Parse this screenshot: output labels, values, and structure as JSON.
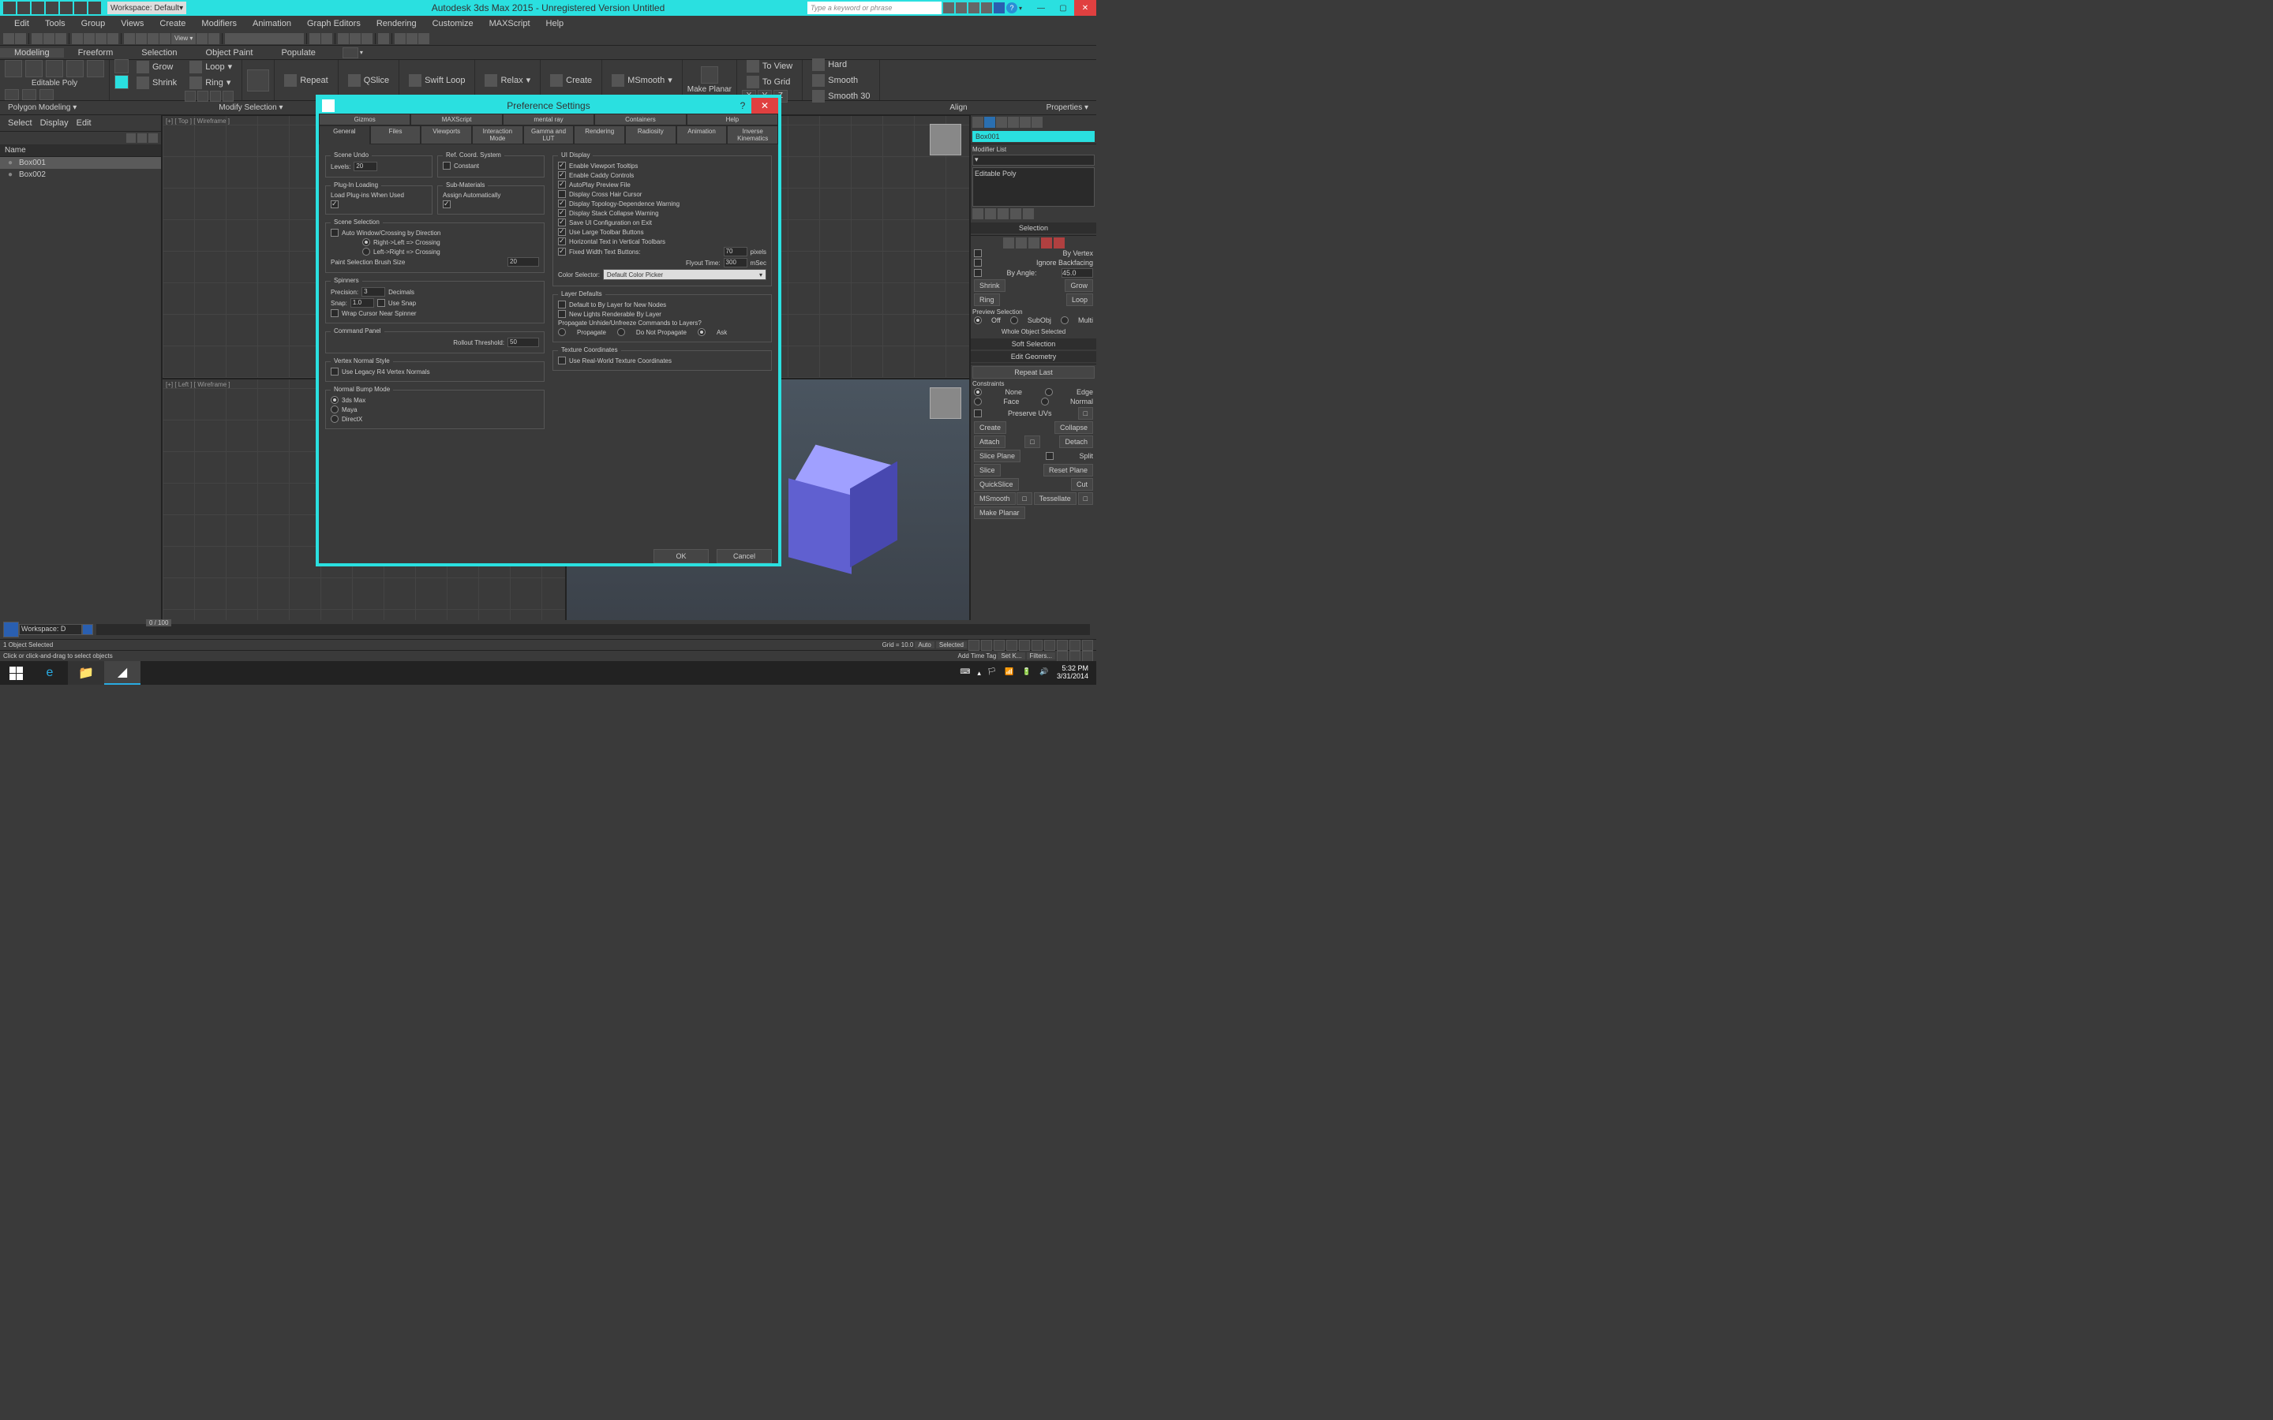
{
  "titlebar": {
    "workspace_label": "Workspace: Default",
    "title": "Autodesk 3ds Max  2015  - Unregistered Version    Untitled",
    "search_placeholder": "Type a keyword or phrase"
  },
  "menus": [
    "Edit",
    "Tools",
    "Group",
    "Views",
    "Create",
    "Modifiers",
    "Animation",
    "Graph Editors",
    "Rendering",
    "Customize",
    "MAXScript",
    "Help"
  ],
  "ribbon_tabs": [
    "Modeling",
    "Freeform",
    "Selection",
    "Object Paint",
    "Populate"
  ],
  "ribbon": {
    "editable_poly": "Editable Poly",
    "grow": "Grow",
    "shrink": "Shrink",
    "loop": "Loop",
    "ring": "Ring",
    "repeat": "Repeat",
    "qslice": "QSlice",
    "swiftloop": "Swift Loop",
    "relax": "Relax",
    "create": "Create",
    "msmooth": "MSmooth",
    "make_planar": "Make Planar",
    "to_view": "To View",
    "to_grid": "To Grid",
    "x": "X",
    "y": "Y",
    "z": "Z",
    "hard": "Hard",
    "smooth": "Smooth",
    "smooth30": "Smooth 30"
  },
  "ribbon_subtabs": [
    "Polygon Modeling ▾",
    "Modify Selection ▾",
    "Align",
    "Properties ▾"
  ],
  "left_panel": {
    "tabs": [
      "Select",
      "Display",
      "Edit"
    ],
    "header": "Name",
    "items": [
      "Box001",
      "Box002"
    ]
  },
  "viewports": {
    "tl": "[+] [ Top ] [ Wireframe ]",
    "tr": "",
    "bl": "[+] [ Left ] [ Wireframe ]",
    "br": ""
  },
  "dialog": {
    "title": "Preference Settings",
    "tabs_row1": [
      "Gizmos",
      "MAXScript",
      "mental ray",
      "Containers",
      "Help"
    ],
    "tabs_row2": [
      "General",
      "Files",
      "Viewports",
      "Interaction Mode",
      "Gamma and LUT",
      "Rendering",
      "Radiosity",
      "Animation",
      "Inverse Kinematics"
    ],
    "scene_undo": "Scene Undo",
    "levels": "Levels:",
    "levels_val": "20",
    "ref_coord": "Ref. Coord. System",
    "constant": "Constant",
    "plugin_loading": "Plug-In Loading",
    "load_plugins": "Load Plug-ins When Used",
    "sub_materials": "Sub-Materials",
    "assign_auto": "Assign Automatically",
    "scene_selection": "Scene Selection",
    "auto_window": "Auto Window/Crossing by Direction",
    "right_left": "Right->Left => Crossing",
    "left_right": "Left->Right => Crossing",
    "paint_brush": "Paint Selection Brush Size",
    "paint_val": "20",
    "spinners": "Spinners",
    "precision": "Precision:",
    "precision_val": "3",
    "decimals": "Decimals",
    "snap": "Snap:",
    "snap_val": "1.0",
    "use_snap": "Use Snap",
    "wrap_cursor": "Wrap Cursor Near Spinner",
    "command_panel": "Command Panel",
    "rollout_threshold": "Rollout Threshold:",
    "rollout_val": "50",
    "vertex_normal": "Vertex Normal Style",
    "use_legacy": "Use Legacy R4 Vertex Normals",
    "normal_bump": "Normal Bump Mode",
    "nbm_3dsmax": "3ds Max",
    "nbm_maya": "Maya",
    "nbm_directx": "DirectX",
    "ui_display": "UI Display",
    "enable_tooltips": "Enable Viewport Tooltips",
    "enable_caddy": "Enable Caddy Controls",
    "autoplay": "AutoPlay Preview File",
    "crosshair": "Display Cross Hair Cursor",
    "topology_warn": "Display Topology-Dependence Warning",
    "stack_warn": "Display Stack Collapse Warning",
    "save_ui": "Save UI Configuration on Exit",
    "large_toolbar": "Use Large Toolbar Buttons",
    "horiz_text": "Horizontal Text in Vertical Toolbars",
    "fixed_width": "Fixed Width Text Buttons:",
    "fixed_width_val": "70",
    "pixels": "pixels",
    "flyout": "Flyout Time:",
    "flyout_val": "300",
    "msec": "mSec",
    "color_selector": "Color Selector:",
    "color_selector_val": "Default Color Picker",
    "layer_defaults": "Layer Defaults",
    "default_by_layer": "Default to By Layer for New Nodes",
    "new_lights": "New Lights Renderable By Layer",
    "propagate_cmd": "Propagate Unhide/Unfreeze Commands to Layers?",
    "propagate": "Propagate",
    "do_not": "Do Not Propagate",
    "ask": "Ask",
    "tex_coords": "Texture Coordinates",
    "use_realworld": "Use Real-World Texture Coordinates",
    "ok": "OK",
    "cancel": "Cancel"
  },
  "right_panel": {
    "obj_name": "Box001",
    "modifier_list": "Modifier List",
    "editable_poly": "Editable Poly",
    "selection": "Selection",
    "by_vertex": "By Vertex",
    "ignore_backfacing": "Ignore Backfacing",
    "by_angle": "By Angle:",
    "by_angle_val": "45.0",
    "shrink": "Shrink",
    "grow": "Grow",
    "ring": "Ring",
    "loop": "Loop",
    "preview_sel": "Preview Selection",
    "off": "Off",
    "subobj": "SubObj",
    "multi": "Multi",
    "whole_object": "Whole Object Selected",
    "soft_selection": "Soft Selection",
    "edit_geometry": "Edit Geometry",
    "repeat_last": "Repeat Last",
    "constraints": "Constraints",
    "none": "None",
    "edge": "Edge",
    "face": "Face",
    "normal": "Normal",
    "preserve_uvs": "Preserve UVs",
    "create": "Create",
    "collapse": "Collapse",
    "attach": "Attach",
    "detach": "Detach",
    "slice_plane": "Slice Plane",
    "split": "Split",
    "slice": "Slice",
    "reset_plane": "Reset Plane",
    "quickslice": "QuickSlice",
    "cut": "Cut",
    "msmooth": "MSmooth",
    "tessellate": "Tessellate",
    "make_planar": "Make Planar"
  },
  "status": {
    "objects_selected": "1 Object Selected",
    "prompt": "Click or click-and-drag to select objects",
    "workspace": "Workspace: D",
    "grid": "Grid = 10.0",
    "add_time_tag": "Add Time Tag",
    "auto": "Auto",
    "selected": "Selected",
    "filters": "Filters...",
    "set_key": "Set K..."
  },
  "taskbar": {
    "time": "5:32 PM",
    "date": "3/31/2014"
  }
}
